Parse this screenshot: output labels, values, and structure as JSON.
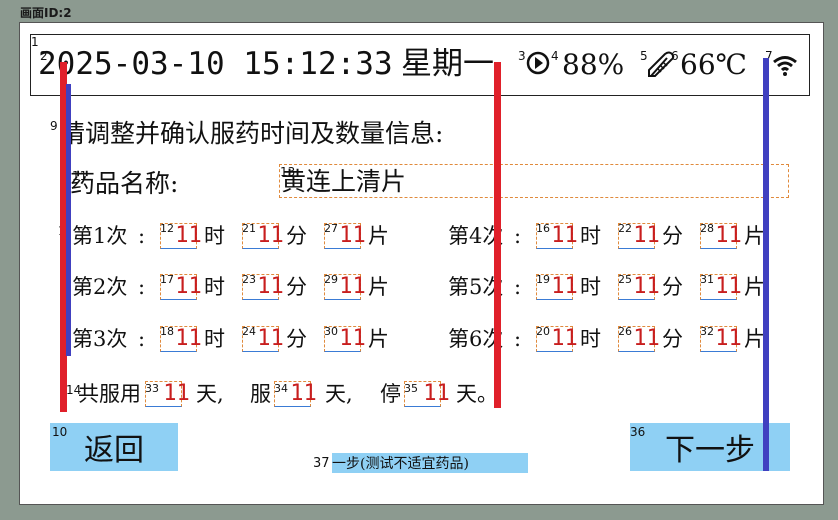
{
  "screen_title": "画面ID:2",
  "status": {
    "datetime": "2025-03-10 15:12:33",
    "weekday": "星期一",
    "battery": "88%",
    "temperature": "66℃",
    "icons": [
      "battery-icon",
      "thermometer-icon",
      "wifi-icon"
    ]
  },
  "heading": "请调整并确认服药时间及数量信息:",
  "drug": {
    "label": "药品名称:",
    "value": "黄连上清片"
  },
  "units": {
    "hour": "时",
    "minute": "分",
    "tablet": "片",
    "colon": ":"
  },
  "doses": [
    {
      "label": "第1次",
      "hour": "11",
      "minute": "11",
      "count": "11",
      "ids": [
        "12",
        "21",
        "27"
      ]
    },
    {
      "label": "第2次",
      "hour": "11",
      "minute": "11",
      "count": "11",
      "ids": [
        "17",
        "23",
        "29"
      ]
    },
    {
      "label": "第3次",
      "hour": "11",
      "minute": "11",
      "count": "11",
      "ids": [
        "18",
        "24",
        "30"
      ]
    },
    {
      "label": "第4次",
      "hour": "11",
      "minute": "11",
      "count": "11",
      "ids": [
        "16",
        "22",
        "28"
      ]
    },
    {
      "label": "第5次",
      "hour": "11",
      "minute": "11",
      "count": "11",
      "ids": [
        "19",
        "25",
        "31"
      ]
    },
    {
      "label": "第6次",
      "hour": "11",
      "minute": "11",
      "count": "11",
      "ids": [
        "20",
        "26",
        "32"
      ]
    }
  ],
  "schedule": {
    "prefix": "共服用",
    "total_days": "11",
    "day_unit": "天,",
    "take_label": "服",
    "take_days": "11",
    "stop_label": "停",
    "stop_days": "11",
    "end": "天。",
    "ids": [
      "33",
      "34",
      "35"
    ]
  },
  "buttons": {
    "back": "返回",
    "next": "下一步",
    "test": "一步(测试不适宜药品)"
  },
  "marker_ids": [
    "1",
    "2",
    "3",
    "4",
    "5",
    "6",
    "7",
    "9",
    "11",
    "13",
    "14",
    "10",
    "36",
    "37",
    "1"
  ],
  "colors": {
    "accent_blue_button": "#8fd0f4",
    "value_red": "#c81e1e",
    "bar_red": "#e0202a",
    "bar_blue": "#4040c0"
  }
}
